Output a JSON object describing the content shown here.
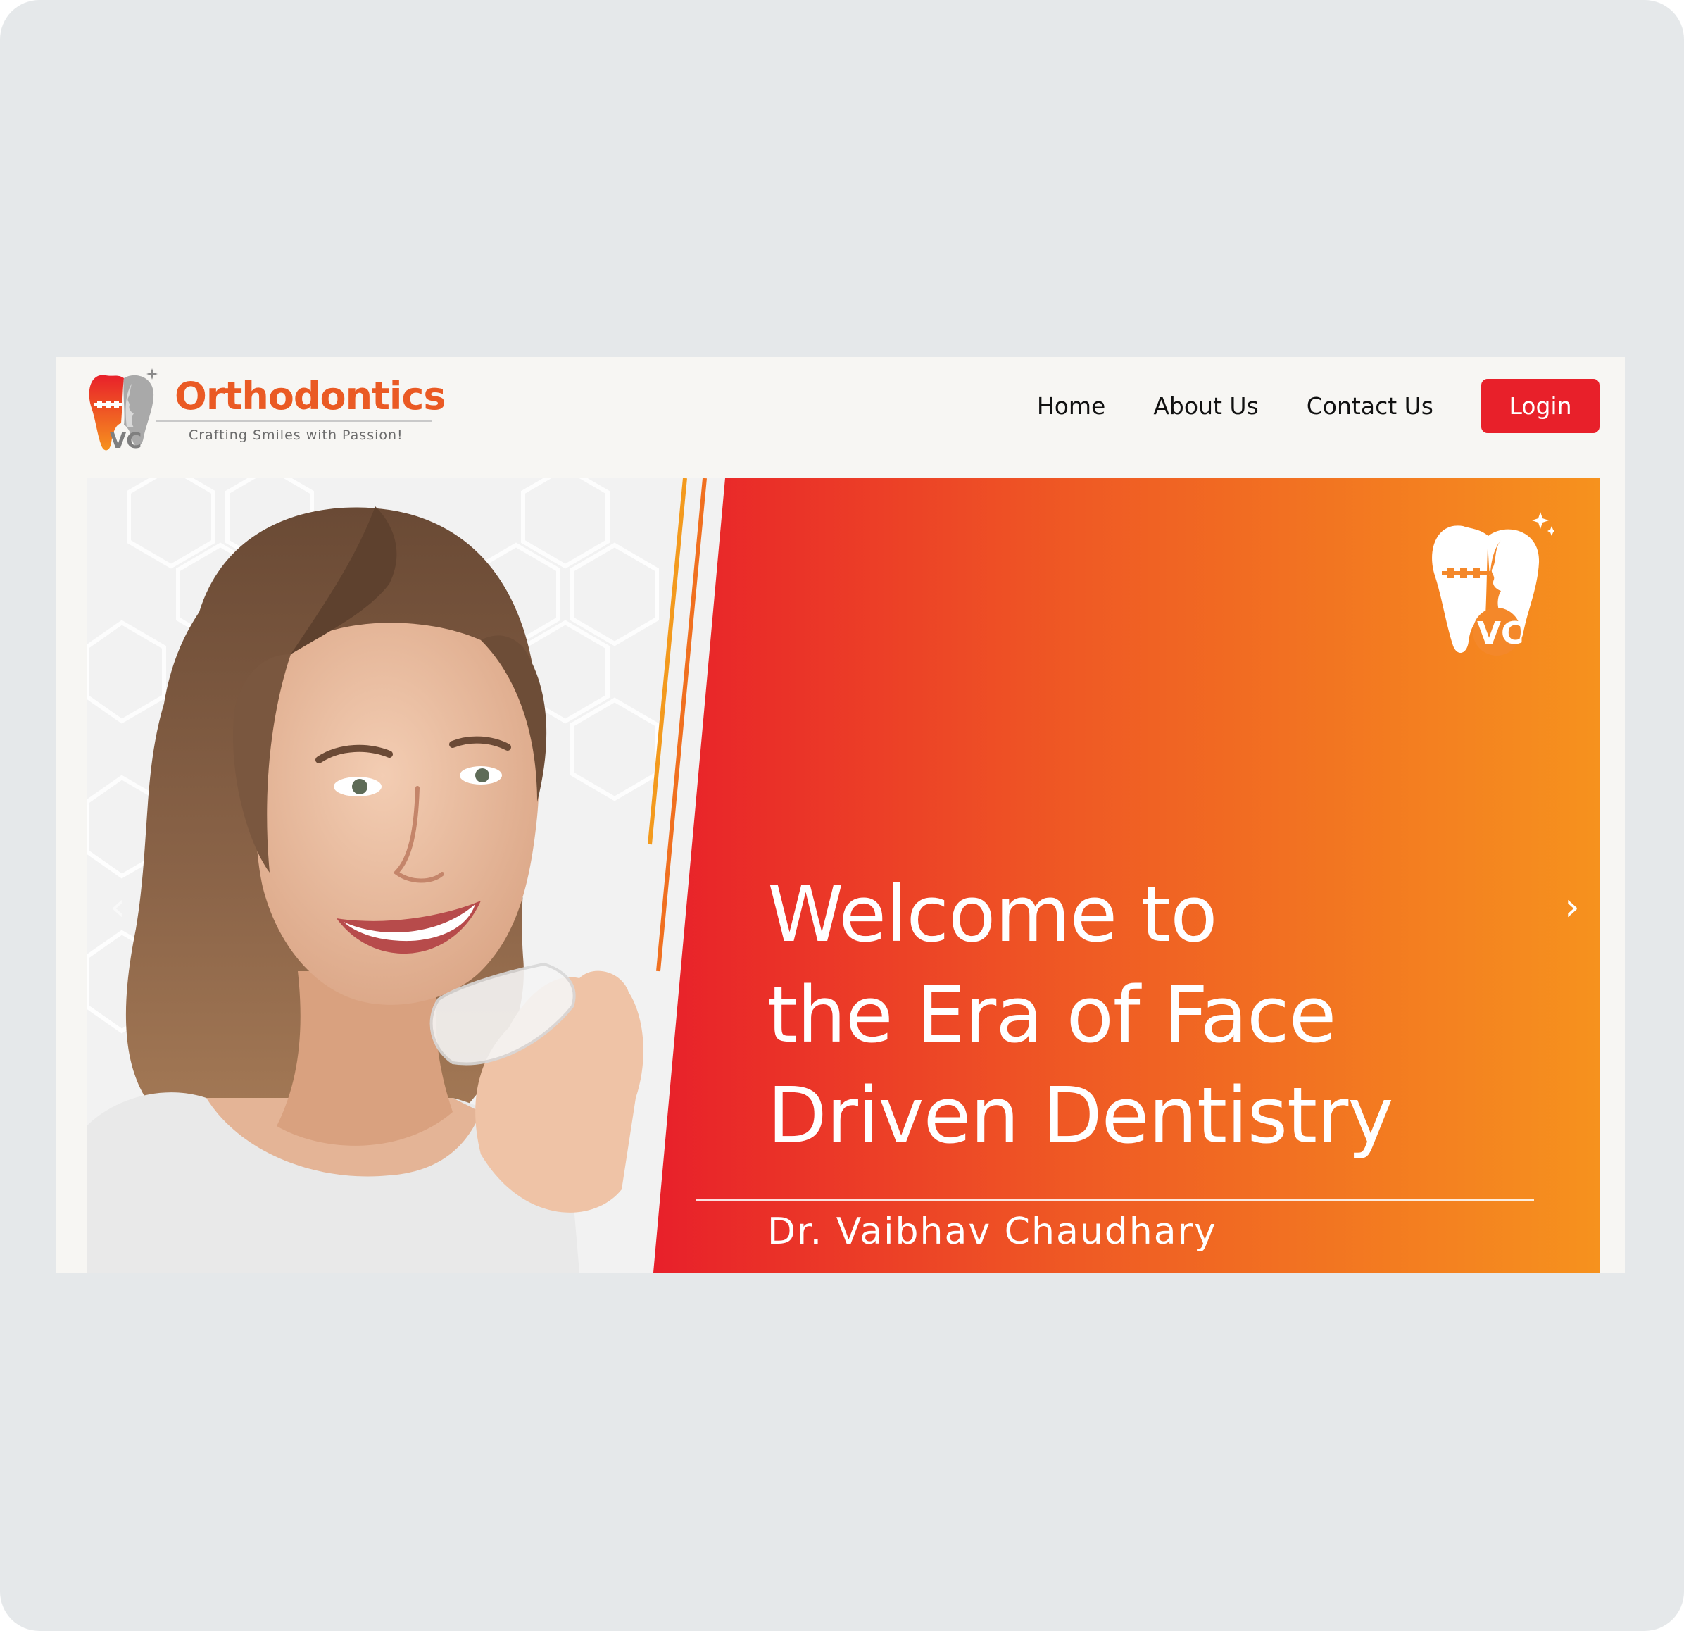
{
  "header": {
    "brand_name": "Orthodontics",
    "tagline": "Crafting Smiles with Passion!",
    "logo_initials": "VC",
    "nav": [
      {
        "label": "Home"
      },
      {
        "label": "About Us"
      },
      {
        "label": "Contact Us"
      }
    ],
    "login_label": "Login"
  },
  "hero": {
    "headline_lines": [
      "Welcome to",
      "the Era of Face",
      "Driven Dentistry"
    ],
    "doctor_name": "Dr. Vaibhav Chaudhary",
    "logo_initials": "VC",
    "next_glyph": "›",
    "prev_glyph": "‹"
  },
  "colors": {
    "brand_orange": "#ea5a24",
    "login_red": "#e8202a",
    "gradient_start": "#e8202a",
    "gradient_end": "#f6921e"
  }
}
